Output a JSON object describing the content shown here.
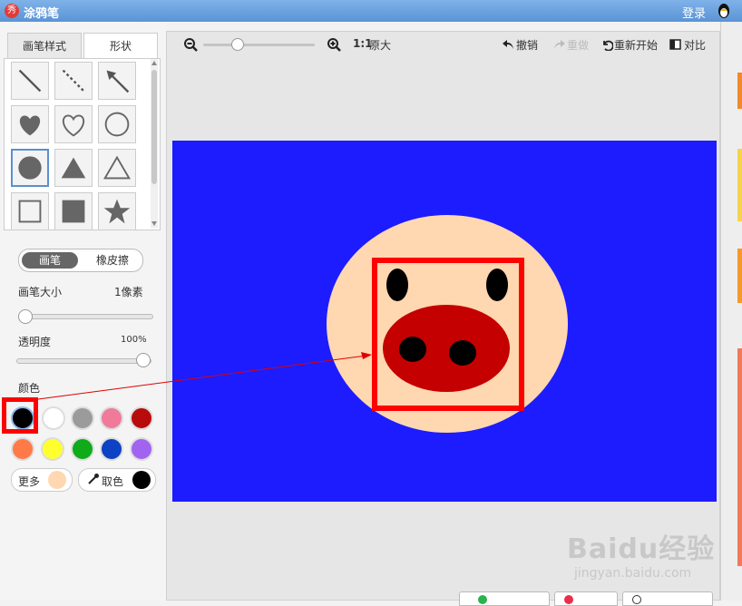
{
  "app": {
    "title": "涂鸦笔",
    "login": "登录"
  },
  "tabs": [
    "画笔样式",
    "形状"
  ],
  "shapes": [
    "line",
    "dashed-line",
    "arrow",
    "heart-filled",
    "heart-outline",
    "circle-outline",
    "circle-filled",
    "triangle-filled",
    "triangle-outline",
    "square-outline",
    "square-filled",
    "star-filled"
  ],
  "mode": {
    "active": "画笔",
    "other": "橡皮擦"
  },
  "brush_size": {
    "label": "画笔大小",
    "value": "1像素",
    "level": 0.0
  },
  "opacity": {
    "label": "透明度",
    "value": "100%",
    "level": 1.0
  },
  "colors": {
    "label": "颜色",
    "swatches": [
      "#000000",
      "#ffffff",
      "#9b9b9b",
      "#f07a9a",
      "#b80c0c",
      "#ff7a47",
      "#ffff2e",
      "#0fab1a",
      "#0c42c4",
      "#a064f0"
    ],
    "selected": "#000000",
    "more_label": "更多",
    "more_color": "#ffd7b0",
    "picker_label": "取色",
    "picker_color": "#000000"
  },
  "toolbar": {
    "zoom_label": "1:1",
    "original_size": "原大",
    "undo": "撤销",
    "redo": "重做",
    "restart": "重新开始",
    "compare": "对比"
  },
  "canvas": {
    "background": "#1c1cff",
    "face": "#ffd7b0",
    "snout": "#c40000",
    "highlight": "#ff0000"
  },
  "watermark": {
    "brand": "Baidu经验",
    "url": "jingyan.baidu.com"
  }
}
